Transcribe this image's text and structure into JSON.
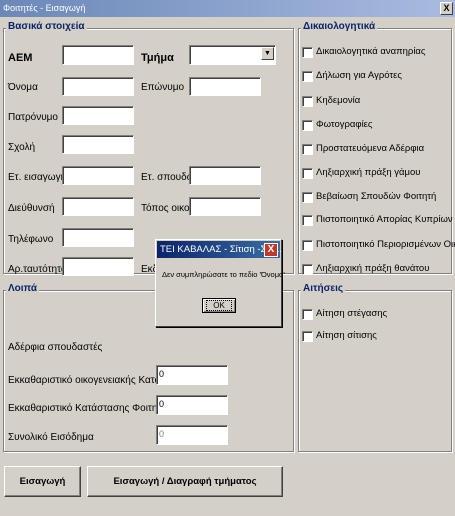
{
  "window": {
    "title": "Φοιτητές - Εισαγωγή",
    "close": "X"
  },
  "basic": {
    "title": "Βασικά στοιχεία",
    "aem": "ΑΕΜ",
    "tmima": "Τμήμα",
    "onoma": "Όνομα",
    "eponymo": "Επώνυμο",
    "patronymo": "Πατρόνυμο",
    "scholi": "Σχολή",
    "etos_eisagogis": "Ετ. εισαγωγής",
    "etos_spoudon": "Ετ. σπουδών",
    "diefthynsi": "Διεύθυνσή",
    "topos_oikou": "Τόπος οικογ.",
    "tilefono": "Τηλέφωνο",
    "ar_taftotitas": "Αρ.ταυτότητας",
    "ek_partial": "Εκδ"
  },
  "docs": {
    "title": "Δικαιολογητικά",
    "items": [
      "Δικαιολογητικά αναπηρίας",
      "Δήλωση για Αγρότες",
      "Κηδεμονία",
      "Φωτογραφίες",
      "Προστατευόμενα Αδέρφια",
      "Ληξιαρχική πράξη γάμου",
      "Βεβαίωση Σπουδών Φοιτητή",
      "Πιστοποιητικό Απορίας Κυπρίων",
      "Πιστοποιητικό Περιορισμένων Οικον",
      "Ληξιαρχική πράξη θανάτου"
    ]
  },
  "other": {
    "title": "Λοιπά",
    "adelfia": "Αδέρφια σπουδαστές",
    "ekk_oikog": "Εκκαθαριστικό οικογενειακής Κατάστασης",
    "ekk_oikog_val": "0",
    "ekk_foititi": "Εκκαθαριστικό Κατάστασης Φοιτητή",
    "ekk_foititi_val": "0",
    "synoliko": "Συνολικό Εισόδημα",
    "synoliko_val": "0"
  },
  "requests": {
    "title": "Αιτήσεις",
    "items": [
      "Αίτηση στέγασης",
      "Αίτηση σίτισης"
    ]
  },
  "buttons": {
    "insert": "Εισαγωγή",
    "insert_delete_dept": "Εισαγωγή / Διαγραφή τμήματος"
  },
  "dialog": {
    "title": "ΤΕΙ ΚΑΒΑΛΑΣ - Σίτιση -Στέ...",
    "close": "X",
    "message": "Δεν συμπληρώσατε το πεδίο 'Όνομα'",
    "ok": "OK"
  }
}
